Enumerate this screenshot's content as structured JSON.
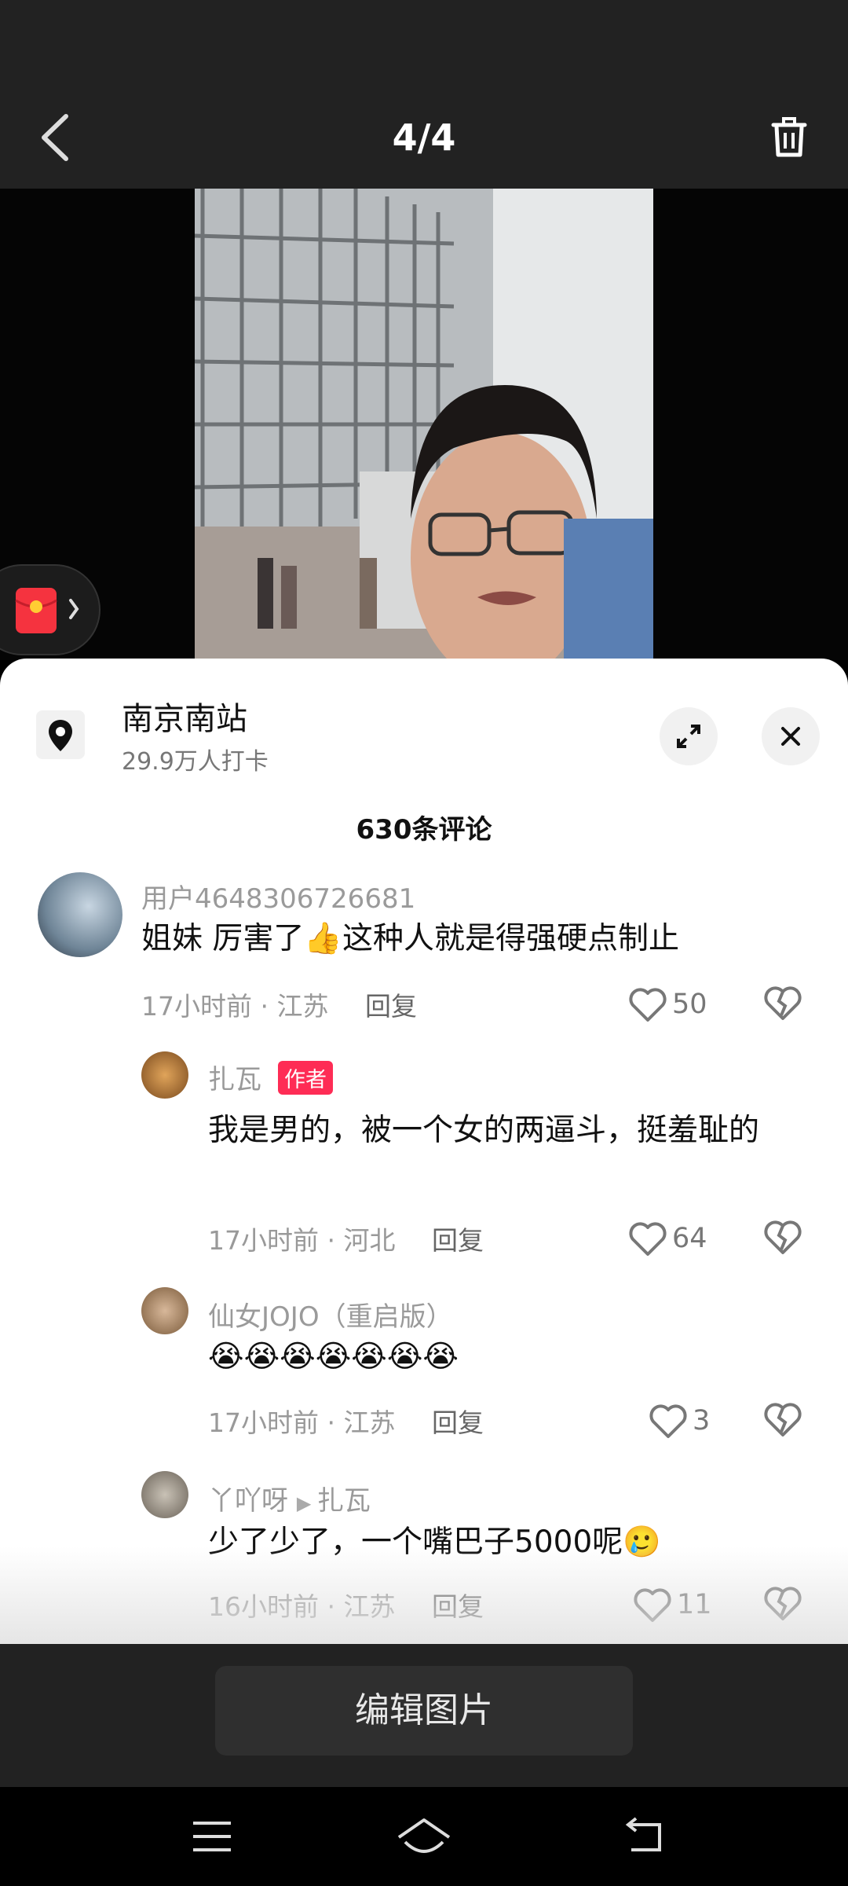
{
  "viewer": {
    "counter": "4/4"
  },
  "location": {
    "name": "南京南站",
    "checkins": "29.9万人打卡"
  },
  "comment_count": "630条评论",
  "comments": [
    {
      "user": "用户4648306726681",
      "text": "姐妹 厉害了👍这种人就是得强硬点制止",
      "time": "17小时前",
      "place": "江苏",
      "reply_label": "回复",
      "likes": "50"
    },
    {
      "user": "扎瓦",
      "badge": "作者",
      "text": "我是男的，被一个女的两逼斗，挺羞耻的",
      "time": "17小时前",
      "place": "河北",
      "reply_label": "回复",
      "likes": "64"
    },
    {
      "user": "仙女JOJO（重启版）",
      "text": "😭😭😭😭😭😭😭",
      "time": "17小时前",
      "place": "江苏",
      "reply_label": "回复",
      "likes": "3"
    },
    {
      "user": "丫吖呀",
      "reply_to": "扎瓦",
      "text": "少了少了，一个嘴巴子5000呢🥲",
      "time": "16小时前",
      "place": "江苏",
      "reply_label": "回复",
      "likes": "11"
    }
  ],
  "edit_button": "编辑图片",
  "colors": {
    "author_badge": "#fe2c55",
    "dark_bar": "#222222"
  }
}
